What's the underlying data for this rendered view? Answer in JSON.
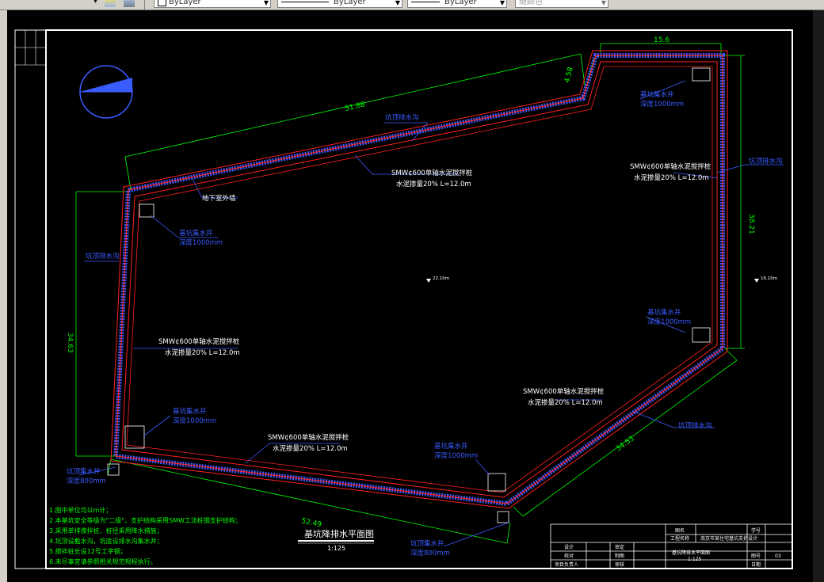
{
  "toolbar": {
    "layer_combo": "ByLayer",
    "linetype_combo": "ByLayer",
    "lineweight_combo": "ByLayer",
    "color_combo": "随颜色"
  },
  "drawing": {
    "title": "基坑降排水平面图",
    "scale": "1:125",
    "dimensions": {
      "top": "15.6",
      "top_left_diag": "51.88",
      "top_right_small": "4.58",
      "right": "38.21",
      "left": "34.63",
      "bottom": "52.49",
      "bottom_right_diag": "34.53"
    },
    "labels": {
      "smw1_line1": "SMW¢600单轴水泥搅拌桩",
      "smw1_line2": "水泥掺量20% L=12.0m",
      "smw2_line1": "SMW¢600单轴水泥搅拌桩",
      "smw2_line2": "水泥掺量20% L=12.0m",
      "smw3_line1": "SMW¢600单轴水泥搅拌桩",
      "smw3_line2": "水泥掺量20% L=12.0m",
      "smw4_line1": "SMW¢600单轴水泥搅拌桩",
      "smw4_line2": "水泥掺量20% L=12.0m",
      "smw5_line1": "SMW¢600单轴水泥搅拌桩",
      "smw5_line2": "水泥掺量20% L=12.0m",
      "basement_wall": "地下室外墙",
      "drain_top": "坑顶排水沟",
      "drain_left": "坑顶排水沟",
      "drain_right": "坑顶排水沟",
      "drain_right2": "坑顶排水沟",
      "well_tl_1": "基坑集水井",
      "well_tl_2": "深度1000mm",
      "well_tr_1": "基坑集水井",
      "well_tr_2": "深度1000mm",
      "well_r_1": "基坑集水井",
      "well_r_2": "深度1000mm",
      "well_bl_1": "基坑集水井",
      "well_bl_2": "深度1000mm",
      "well_b_1": "基坑集水井",
      "well_b_2": "深度1000mm",
      "topwell_l_1": "坑顶集水井",
      "topwell_l_2": "深度800mm",
      "topwell_b_1": "坑顶集水井",
      "topwell_b_2": "深度800mm",
      "elev_center": "22.10m",
      "elev_right": "16.10m"
    },
    "notes": [
      "1.图中单位均以m计；",
      "2.本基坑安全等级为\"二级\"，支护结构采用SMW工法桩钢支护结构；",
      "3.采用单排搅拌桩，桩径采用降水措施；",
      "4.坑顶设截水沟，坑底设排水沟集水井；",
      "5.搅拌桩长设12号工字钢；",
      "6.未尽事宜请参照相关规范规程执行。"
    ]
  },
  "title_block": {
    "project_label": "工程名称",
    "project_value": "南京市某住宅基坑支护设计",
    "drawing_no_label": "学号",
    "drawing_label": "图名",
    "drawing_value": "基坑降排水平面图",
    "scale_value": "1:125",
    "sheet_label": "图号",
    "sheet_value": "03",
    "date_label": "日期",
    "design_label": "设计",
    "check_label": "审定",
    "review_label": "校对",
    "draw_label": "制图",
    "approve_label": "项目负责人",
    "verify_label": "审核"
  },
  "colors": {
    "background": "#000000",
    "frame": "#ffffff",
    "pit_outline": "#ff2020",
    "pile_hatch": "#3a5bff",
    "dimension": "#00ff00",
    "text_label": "#ffffff",
    "blue_text": "#3a5bff",
    "note_text": "#00ff00"
  }
}
